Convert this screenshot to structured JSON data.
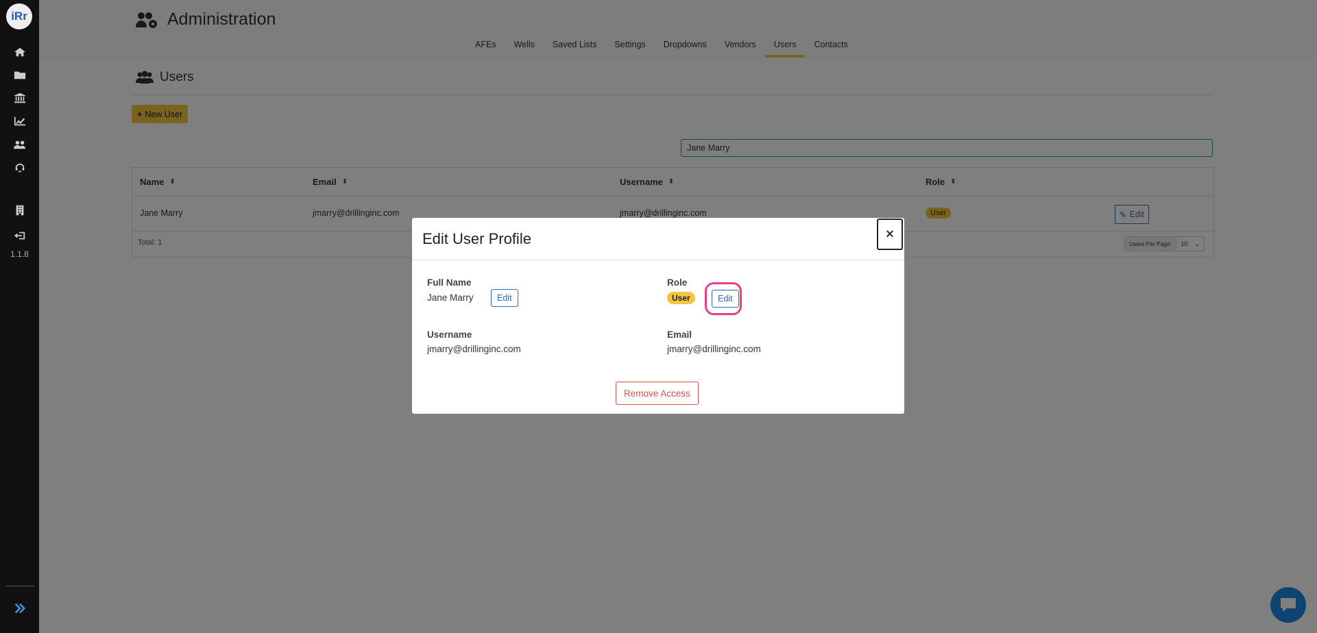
{
  "sidebar": {
    "logo_text": "iRr",
    "icons": [
      "home-icon",
      "folder-icon",
      "bank-icon",
      "chart-icon",
      "users-cog-icon",
      "support-icon",
      "building-icon",
      "sign-out-icon"
    ],
    "version": "1.1.8",
    "expand_icon": "double-chevron-right-icon"
  },
  "header": {
    "title": "Administration",
    "tabs": [
      "AFEs",
      "Wells",
      "Saved Lists",
      "Settings",
      "Dropdowns",
      "Vendors",
      "Users",
      "Contacts"
    ],
    "active_tab": "Users"
  },
  "section": {
    "title": "Users",
    "new_user_label": "New User",
    "search_value": "Jane Marry"
  },
  "table": {
    "columns": [
      "Name",
      "Email",
      "Username",
      "Role"
    ],
    "rows": [
      {
        "name": "Jane Marry",
        "email": "jmarry@drillinginc.com",
        "username": "jmarry@drillinginc.com",
        "role": "User",
        "action": "Edit"
      }
    ],
    "total": "Total: 1",
    "per_page_label": "Users Per Page:",
    "per_page_value": "10"
  },
  "modal": {
    "title": "Edit User Profile",
    "close": "×",
    "full_name_label": "Full Name",
    "full_name_value": "Jane Marry",
    "role_label": "Role",
    "role_value": "User",
    "username_label": "Username",
    "username_value": "jmarry@drillinginc.com",
    "email_label": "Email",
    "email_value": "jmarry@drillinginc.com",
    "edit_label": "Edit",
    "remove_label": "Remove Access"
  },
  "colors": {
    "accent": "#f5c542",
    "link": "#2a6ab8",
    "danger": "#d9534f",
    "highlight": "#e83e8c",
    "chat": "#1e88e5"
  }
}
